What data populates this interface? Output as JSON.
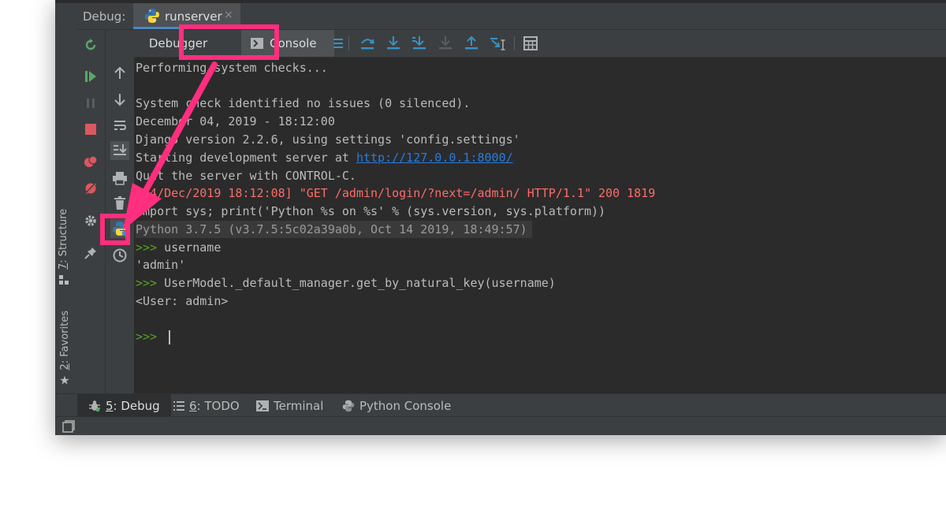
{
  "side_tabs": {
    "structure": {
      "number": "7",
      "label": ": Structure"
    },
    "favorites": {
      "number": "2",
      "label": ": Favorites"
    }
  },
  "debug_header": {
    "label": "Debug:",
    "active_tab": "runserver",
    "close_glyph": "×"
  },
  "toolbar": {
    "debugger_tab": "Debugger",
    "console_tab": "Console",
    "icons": [
      "console-icon",
      "step-over-icon",
      "step-into-icon",
      "step-into-my-code-icon",
      "force-step-into-icon",
      "step-out-icon",
      "run-to-cursor-icon",
      "evaluate-expression-icon"
    ]
  },
  "console": {
    "lines": {
      "l1": "Performing system checks...",
      "l2": "System check identified no issues (0 silenced).",
      "l3": "December 04, 2019 - 18:12:00",
      "l4": "Django version 2.2.6, using settings 'config.settings'",
      "l5_prefix": "Starting development server at ",
      "l5_link": "http://127.0.0.1:8000/",
      "l6": "Quit the server with CONTROL-C.",
      "l7": "[04/Dec/2019 18:12:08] \"GET /admin/login/?next=/admin/ HTTP/1.1\" 200 1819",
      "l8": "import sys; print('Python %s on %s' % (sys.version, sys.platform))",
      "l9": "Python 3.7.5 (v3.7.5:5c02a39a0b, Oct 14 2019, 18:49:57)",
      "l10_prompt": ">>> ",
      "l10_cmd": "username",
      "l11": "'admin'",
      "l12_prompt": ">>> ",
      "l12_cmd": "UserModel._default_manager.get_by_natural_key(username)",
      "l13": "<User: admin>",
      "l14_prompt": ">>> "
    }
  },
  "bottom_tabs": {
    "debug": {
      "number": "5",
      "label": ": Debug"
    },
    "todo": {
      "number": "6",
      "label": ": TODO"
    },
    "terminal": "Terminal",
    "python_console": "Python Console"
  },
  "colors": {
    "highlight": "#ff2e7e",
    "console_bg": "#2b2b2b",
    "error_text": "#ff6b68",
    "link": "#287bde",
    "prompt": "#58a022",
    "accent_blue": "#3592c4"
  }
}
